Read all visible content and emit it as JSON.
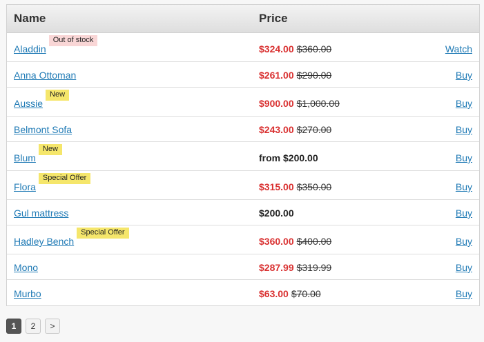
{
  "table": {
    "headers": {
      "name": "Name",
      "price": "Price"
    },
    "rows": [
      {
        "name": "Aladdin",
        "badge": "Out of stock",
        "badge_type": "oos",
        "sale": "$324.00",
        "old": "$360.00",
        "plain": "",
        "action": "Watch"
      },
      {
        "name": "Anna Ottoman",
        "badge": "",
        "badge_type": "",
        "sale": "$261.00",
        "old": "$290.00",
        "plain": "",
        "action": "Buy"
      },
      {
        "name": "Aussie",
        "badge": "New",
        "badge_type": "new",
        "sale": "$900.00",
        "old": "$1,000.00",
        "plain": "",
        "action": "Buy"
      },
      {
        "name": "Belmont Sofa",
        "badge": "",
        "badge_type": "",
        "sale": "$243.00",
        "old": "$270.00",
        "plain": "",
        "action": "Buy"
      },
      {
        "name": "Blum",
        "badge": "New",
        "badge_type": "new",
        "sale": "",
        "old": "",
        "plain": "from $200.00",
        "action": "Buy"
      },
      {
        "name": "Flora",
        "badge": "Special Offer",
        "badge_type": "special",
        "sale": "$315.00",
        "old": "$350.00",
        "plain": "",
        "action": "Buy"
      },
      {
        "name": "Gul mattress",
        "badge": "",
        "badge_type": "",
        "sale": "",
        "old": "",
        "plain": "$200.00",
        "action": "Buy"
      },
      {
        "name": "Hadley Bench",
        "badge": "Special Offer",
        "badge_type": "special",
        "sale": "$360.00",
        "old": "$400.00",
        "plain": "",
        "action": "Buy"
      },
      {
        "name": "Mono",
        "badge": "",
        "badge_type": "",
        "sale": "$287.99",
        "old": "$319.99",
        "plain": "",
        "action": "Buy"
      },
      {
        "name": "Murbo",
        "badge": "",
        "badge_type": "",
        "sale": "$63.00",
        "old": "$70.00",
        "plain": "",
        "action": "Buy"
      }
    ]
  },
  "pagination": {
    "pages": [
      "1",
      "2"
    ],
    "current": "1",
    "next_label": ">"
  },
  "colors": {
    "link": "#1f7ab5",
    "sale_price": "#d93030",
    "badge_yellow": "#f5e66b",
    "badge_pink": "#f9d6d6",
    "active_page": "#555555"
  }
}
